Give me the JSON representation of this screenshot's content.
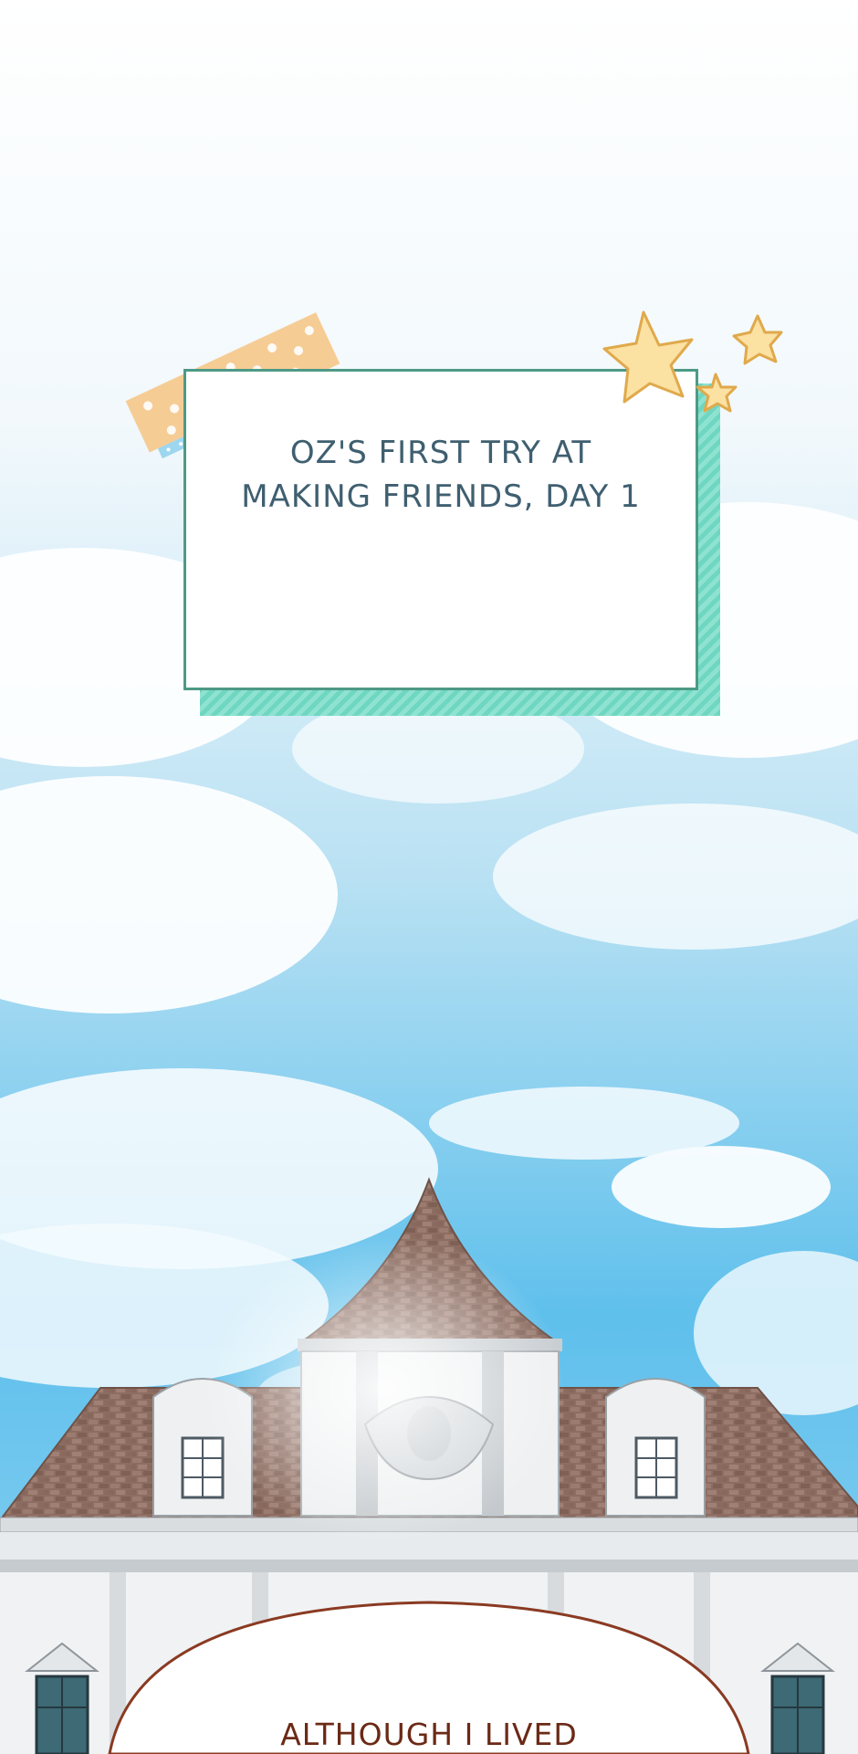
{
  "caption_top": {
    "lines": [
      "OZ'S FIRST TRY AT",
      "MAKING FRIENDS, DAY 1"
    ],
    "accent_color": "#6fd6c1",
    "text_color": "#3f5f70"
  },
  "caption_bottom": {
    "text": "ALTHOUGH I LIVED",
    "text_color": "#6b2a16",
    "bubble_border_color": "#8a3a22"
  },
  "palette": {
    "sky_light": "#eaf6fb",
    "sky_blue": "#3fb1e6",
    "roof_brick": "#8a6a5e",
    "wall": "#eef0f1",
    "tape": "#f5c98f",
    "tape_stripe": "#9dd6ef",
    "star": "#fbe1a2"
  },
  "decorations": [
    "washi-tape",
    "star-sticker",
    "star-sticker",
    "star-sticker"
  ]
}
